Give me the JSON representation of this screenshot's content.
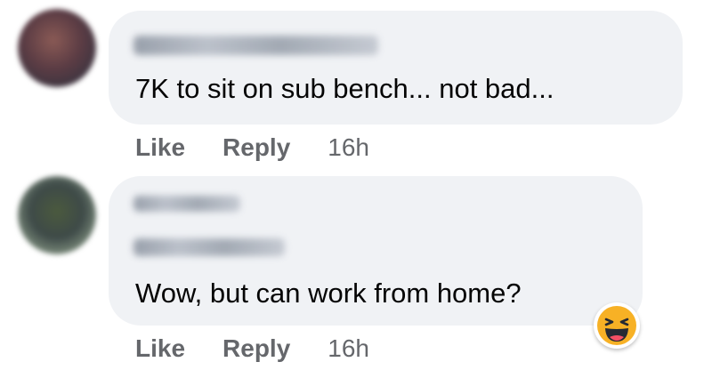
{
  "comments": [
    {
      "text": "7K to sit on sub bench... not bad...",
      "actions": {
        "like": "Like",
        "reply": "Reply",
        "time": "16h"
      }
    },
    {
      "text": "Wow, but can work from home?",
      "actions": {
        "like": "Like",
        "reply": "Reply",
        "time": "16h"
      },
      "reaction": "haha-icon"
    }
  ],
  "colors": {
    "bubble": "#f0f2f5",
    "meta_text": "#65676b",
    "body_text": "#050505",
    "haha_face": "#f7b125"
  }
}
